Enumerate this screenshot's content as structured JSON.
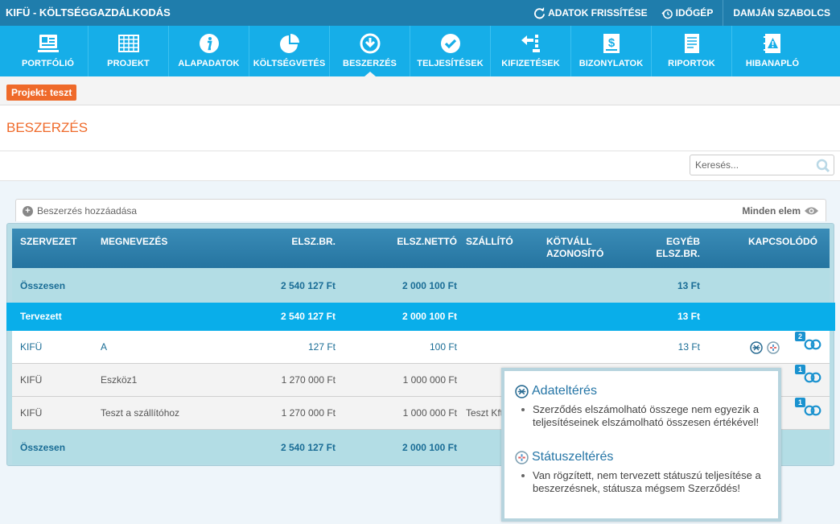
{
  "app": {
    "title": "KIFÜ - KÖLTSÉGGAZDÁLKODÁS",
    "refresh_label": "ADATOK FRISSÍTÉSE",
    "timemachine_label": "IDŐGÉP",
    "user_name": "DAMJÁN SZABOLCS"
  },
  "nav": {
    "items": [
      {
        "label": "PORTFÓLIÓ",
        "icon": "portfolio-icon"
      },
      {
        "label": "PROJEKT",
        "icon": "grid-icon"
      },
      {
        "label": "ALAPADATOK",
        "icon": "info-icon"
      },
      {
        "label": "KÖLTSÉGVETÉS",
        "icon": "pie-chart-icon"
      },
      {
        "label": "BESZERZÉS",
        "icon": "download-circle-icon",
        "active": true
      },
      {
        "label": "TELJESÍTÉSEK",
        "icon": "check-circle-icon"
      },
      {
        "label": "KIFIZETÉSEK",
        "icon": "payment-arrow-icon"
      },
      {
        "label": "BIZONYLATOK",
        "icon": "dollar-document-icon"
      },
      {
        "label": "RIPORTOK",
        "icon": "report-document-icon"
      },
      {
        "label": "HIBANAPLÓ",
        "icon": "warning-notebook-icon"
      }
    ]
  },
  "project_badge": "Projekt: teszt",
  "page_title": "BESZERZÉS",
  "search": {
    "placeholder": "Keresés..."
  },
  "toolbar": {
    "add_label": "Beszerzés hozzáadása",
    "all_items_label": "Minden elem"
  },
  "table": {
    "headers": {
      "org": "SZERVEZET",
      "name": "MEGNEVEZÉS",
      "gross": "ELSZ.BR.",
      "net": "ELSZ.NETTÓ",
      "supplier": "SZÁLLÍTÓ",
      "commitment_1": "KÖTVÁLL",
      "commitment_2": "AZONOSÍTÓ",
      "other_1": "EGYÉB",
      "other_2": "ELSZ.BR.",
      "related": "KAPCSOLÓDÓ"
    },
    "total_top": {
      "label": "Összesen",
      "gross": "2 540 127 Ft",
      "net": "2 000 100 Ft",
      "other": "13 Ft"
    },
    "planned": {
      "label": "Tervezett",
      "gross": "2 540 127 Ft",
      "net": "2 000 100 Ft",
      "other": "13 Ft"
    },
    "rows": [
      {
        "org": "KIFÜ",
        "name": "A",
        "gross": "127 Ft",
        "net": "100 Ft",
        "supplier": "",
        "other": "13 Ft",
        "related_count": "2"
      },
      {
        "org": "KIFÜ",
        "name": "Eszköz1",
        "gross": "1 270 000 Ft",
        "net": "1 000 000 Ft",
        "supplier": "",
        "other": "",
        "related_count": "1"
      },
      {
        "org": "KIFÜ",
        "name": "Teszt a szállítóhoz",
        "gross": "1 270 000 Ft",
        "net": "1 000 000 Ft",
        "supplier": "Teszt Kft",
        "other": "",
        "related_count": "1"
      }
    ],
    "total_bottom": {
      "label": "Összesen",
      "gross": "2 540 127 Ft",
      "net": "2 000 100 Ft"
    }
  },
  "tooltip": {
    "sections": [
      {
        "title": "Adateltérés",
        "text": "Szerződés elszámolható összege nem egyezik a teljesítéseinek elszámolható összesen értékével!"
      },
      {
        "title": "Státuszeltérés",
        "text": "Van rögzített, nem tervezett státuszú teljesítése a beszerzésnek, státusza mégsem Szerződés!"
      }
    ]
  },
  "colors": {
    "topbar": "#1f7dac",
    "nav": "#16aee8",
    "accent": "#ef6a2a",
    "planned_row": "#09aeea",
    "link": "#1a6d96"
  }
}
